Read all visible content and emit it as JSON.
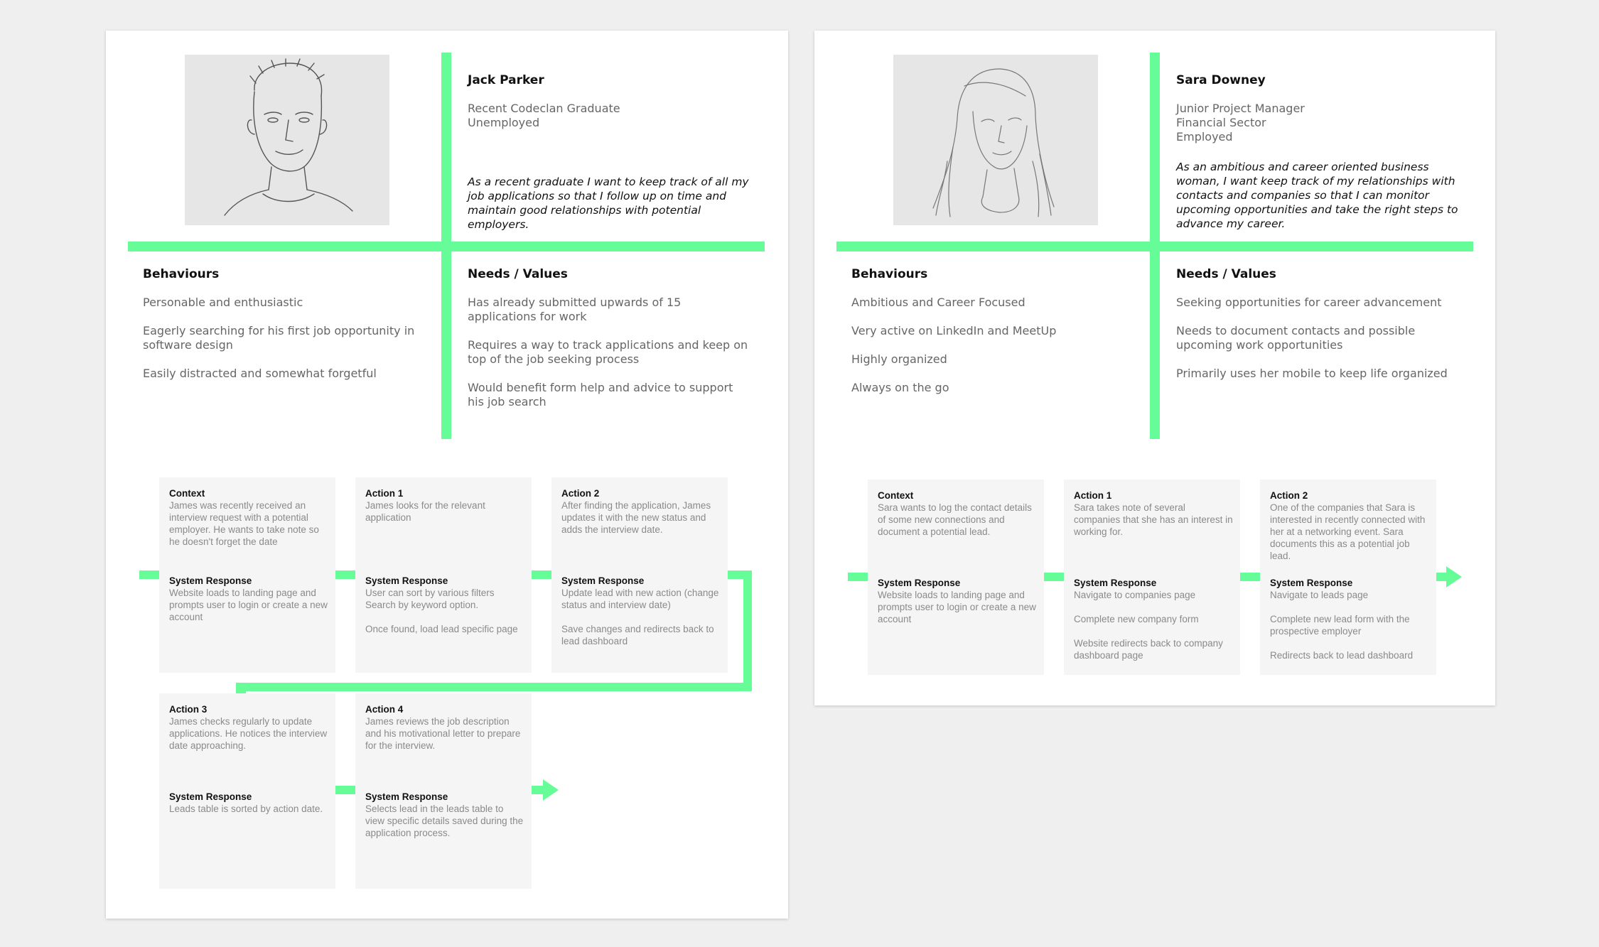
{
  "personas": [
    {
      "name": "Jack Parker",
      "role_lines": [
        "Recent Codeclan Graduate",
        "Unemployed"
      ],
      "story": "As a recent graduate I want to keep track of all my job applications so that I follow up on time and maintain good relationships with potential employers.",
      "behaviours_title": "Behaviours",
      "behaviours": [
        "Personable and enthusiastic",
        "Eagerly searching for his first job opportunity in software design",
        "Easily distracted and somewhat forgetful"
      ],
      "needs_title": "Needs / Values",
      "needs": [
        "Has already submitted upwards of 15 applications for work",
        "Requires a way to track applications and keep on top of the job seeking process",
        "Would benefit form help and advice to support his job search"
      ],
      "journey": [
        {
          "title": "Context",
          "text": "James was recently received an interview request with a potential employer. He wants to take note so he doesn't forget the date",
          "response_title": "System Response",
          "responses": [
            "Website loads to landing page and prompts user to login or create a new account"
          ]
        },
        {
          "title": "Action 1",
          "text": "James looks for the relevant application",
          "response_title": "System Response",
          "responses": [
            "User can sort by various filters Search by keyword option.",
            "Once found, load lead specific page"
          ]
        },
        {
          "title": "Action 2",
          "text": "After finding the application, James updates it with the new status and adds the interview date.",
          "response_title": "System Response",
          "responses": [
            "Update lead with new action (change status and interview date)",
            "Save changes and redirects back to lead dashboard"
          ]
        },
        {
          "title": "Action 3",
          "text": "James checks regularly to update applications. He notices the interview date approaching.",
          "response_title": "System Response",
          "responses": [
            "Leads table is sorted by action date."
          ]
        },
        {
          "title": "Action 4",
          "text": "James reviews the job description and his motivational letter to prepare for the interview.",
          "response_title": "System Response",
          "responses": [
            "Selects lead in the leads table to view specific details saved during the application process."
          ]
        }
      ]
    },
    {
      "name": "Sara Downey",
      "role_lines": [
        "Junior Project Manager",
        "Financial Sector",
        "Employed"
      ],
      "story": "As an ambitious and career oriented business woman, I want keep track of my relationships with contacts and companies so that I can monitor upcoming opportunities and take the right steps to advance my career.",
      "behaviours_title": "Behaviours",
      "behaviours": [
        "Ambitious and Career Focused",
        "Very active on LinkedIn and MeetUp",
        "Highly organized",
        "Always on the go"
      ],
      "needs_title": "Needs / Values",
      "needs": [
        "Seeking opportunities for career advancement",
        "Needs to document contacts and possible upcoming work opportunities",
        "Primarily uses her mobile to keep life organized"
      ],
      "journey": [
        {
          "title": "Context",
          "text": "Sara wants to log the contact details of some new connections and document a potential lead.",
          "response_title": "System Response",
          "responses": [
            "Website loads to landing page and prompts user to login or create a new account"
          ]
        },
        {
          "title": "Action 1",
          "text": "Sara takes note of several companies that she has an interest in working for.",
          "response_title": "System Response",
          "responses": [
            "Navigate to companies page",
            "Complete new company form",
            "Website redirects back to company dashboard page"
          ]
        },
        {
          "title": "Action 2",
          "text": "One of the companies that Sara is interested in recently connected with her at a networking event. Sara documents this as a potential job lead.",
          "response_title": "System Response",
          "responses": [
            "Navigate to leads page",
            "Complete new lead form with the prospective employer",
            "Redirects back to lead dashboard"
          ]
        }
      ]
    }
  ],
  "colors": {
    "accent": "#66fc98",
    "box": "#f5f5f5",
    "text_muted": "#666666"
  }
}
